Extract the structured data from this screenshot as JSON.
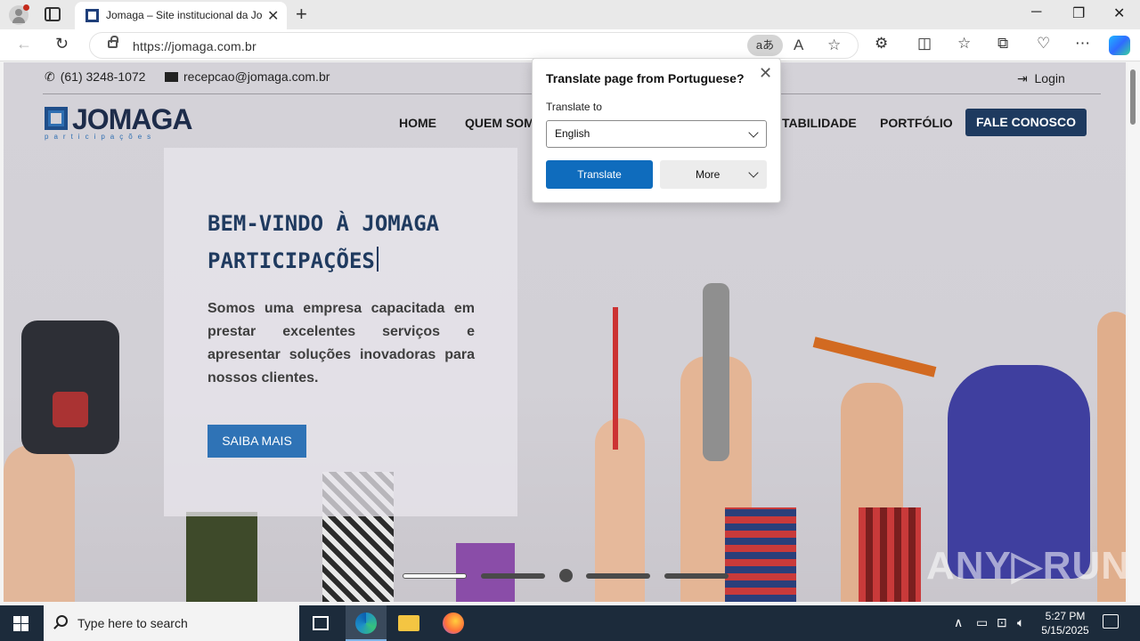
{
  "browser": {
    "tab_title": "Jomaga – Site institucional da Jomaga",
    "url": "https://jomaga.com.br",
    "translate_pill": "aあ"
  },
  "site": {
    "phone": "(61) 3248-1072",
    "email": "recepcao@jomaga.com.br",
    "login": "Login",
    "logo_text": "JOMAGA",
    "logo_sub": "participações",
    "menu": [
      "HOME",
      "QUEM SOM",
      "TABILIDADE",
      "PORTFÓLIO"
    ],
    "cta": "FALE CONOSCO",
    "hero": {
      "title": "BEM-VINDO À JOMAGA PARTICIPAÇÕES",
      "description": "Somos uma empresa capacitada em prestar excelentes serviços e apresentar soluções inovadoras para nossos clientes.",
      "button": "SAIBA MAIS"
    },
    "watermark": "ANY▷RUN"
  },
  "translate_popup": {
    "title": "Translate page from Portuguese?",
    "label": "Translate to",
    "selected_language": "English",
    "translate_button": "Translate",
    "more_button": "More"
  },
  "taskbar": {
    "search_placeholder": "Type here to search",
    "time": "5:27 PM",
    "date": "5/15/2025"
  },
  "colors": {
    "accent": "#0f6cbd",
    "brand_navy": "#1e3a5f",
    "brand_blue": "#2f73b6",
    "taskbar": "#1c2b3b"
  }
}
